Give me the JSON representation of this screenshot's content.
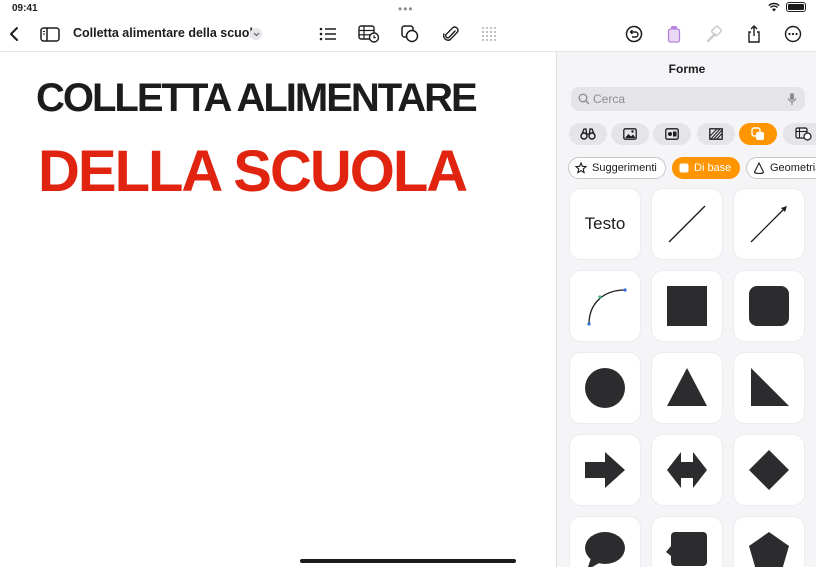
{
  "status": {
    "time": "09:41",
    "dots": "•••"
  },
  "toolbar": {
    "doc_title": "Colletta alimentare della scuola"
  },
  "document": {
    "line1": "COLLETTA ALIMENTARE",
    "line2": "DELLA SCUOLA",
    "line1_color": "#1c1c1e",
    "line2_color": "#e0240f"
  },
  "panel": {
    "title": "Forme",
    "search_placeholder": "Cerca",
    "chips": [
      "Suggerimenti",
      "Di base",
      "Geometria"
    ],
    "text_tile": "Testo",
    "accent": "#ff9500"
  }
}
